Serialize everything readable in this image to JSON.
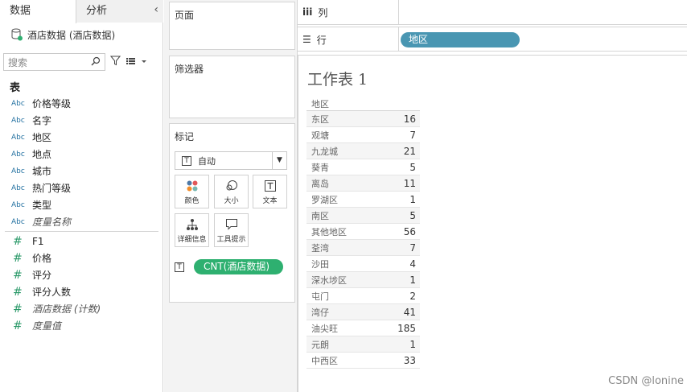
{
  "tabs": {
    "data": "数据",
    "analysis": "分析",
    "collapse": "‹"
  },
  "datasource": "酒店数据 (酒店数据)",
  "search": {
    "placeholder": "搜索"
  },
  "section_table": "表",
  "fields": [
    {
      "type": "Abc",
      "name": "价格等级"
    },
    {
      "type": "Abc",
      "name": "名字"
    },
    {
      "type": "Abc",
      "name": "地区"
    },
    {
      "type": "Abc",
      "name": "地点"
    },
    {
      "type": "Abc",
      "name": "城市"
    },
    {
      "type": "Abc",
      "name": "热门等级"
    },
    {
      "type": "Abc",
      "name": "类型"
    },
    {
      "type": "Abc",
      "name": "度量名称"
    }
  ],
  "measures": [
    {
      "type": "#",
      "name": "F1"
    },
    {
      "type": "#",
      "name": "价格"
    },
    {
      "type": "#",
      "name": "评分"
    },
    {
      "type": "#",
      "name": "评分人数"
    },
    {
      "type": "#",
      "name": "酒店数据 (计数)"
    },
    {
      "type": "#",
      "name": "度量值"
    }
  ],
  "cards": {
    "pages": "页面",
    "filters": "筛选器",
    "marks": "标记"
  },
  "marks": {
    "type": "自动",
    "type_icon": "T",
    "color": "颜色",
    "size": "大小",
    "text": "文本",
    "detail": "详细信息",
    "tooltip": "工具提示",
    "pill": "CNT(酒店数据)"
  },
  "shelves": {
    "columns": "列",
    "rows": "行",
    "row_pill": "地区",
    "columns_icon": "iii",
    "rows_icon": "☰"
  },
  "sheet": {
    "title": "工作表 1",
    "header": "地区",
    "rows": [
      {
        "name": "东区",
        "value": "16"
      },
      {
        "name": "观塘",
        "value": "7"
      },
      {
        "name": "九龙城",
        "value": "21"
      },
      {
        "name": "葵青",
        "value": "5"
      },
      {
        "name": "离岛",
        "value": "11"
      },
      {
        "name": "罗湖区",
        "value": "1"
      },
      {
        "name": "南区",
        "value": "5"
      },
      {
        "name": "其他地区",
        "value": "56"
      },
      {
        "name": "荃湾",
        "value": "7"
      },
      {
        "name": "沙田",
        "value": "4"
      },
      {
        "name": "深水埗区",
        "value": "1"
      },
      {
        "name": "屯门",
        "value": "2"
      },
      {
        "name": "湾仔",
        "value": "41"
      },
      {
        "name": "油尖旺",
        "value": "185"
      },
      {
        "name": "元朗",
        "value": "1"
      },
      {
        "name": "中西区",
        "value": "33"
      }
    ]
  },
  "watermark": "CSDN @lonine",
  "colors": {
    "row_pill": "#4996b2",
    "marks_pill": "#2eb070"
  }
}
